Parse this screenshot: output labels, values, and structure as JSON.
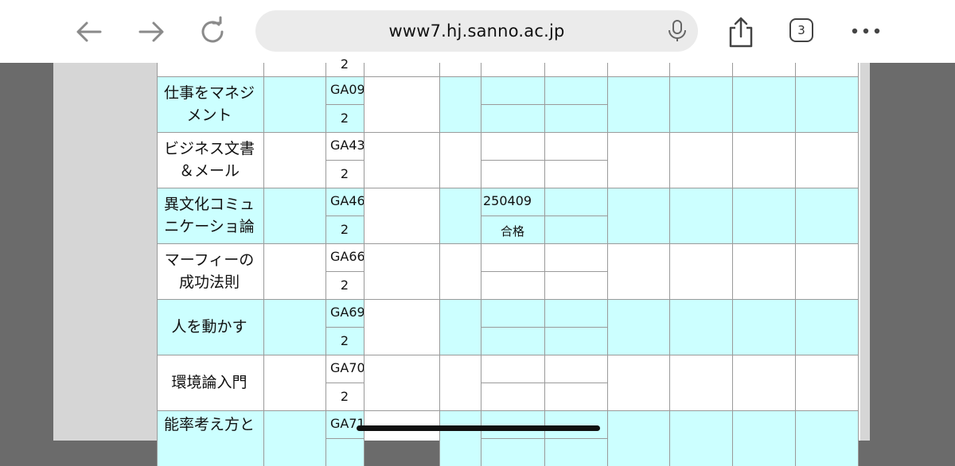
{
  "browser": {
    "url": "www7.hj.sanno.ac.jp",
    "tab_count": "3",
    "icons": [
      "back-arrow-icon",
      "forward-arrow-icon",
      "reload-icon",
      "microphone-icon",
      "share-icon",
      "tabs-icon",
      "more-icon"
    ]
  },
  "table": {
    "top_partial_credit": "2",
    "rows": [
      {
        "name": "仕事をマネジメント",
        "name_line1": "仕事をマネジ",
        "name_line2": "メント",
        "code": "GA09",
        "credit": "2",
        "date": "",
        "result": "",
        "shade": "cyan"
      },
      {
        "name_line1": "ビジネス文書",
        "name_line2": "＆メール",
        "code": "GA43",
        "credit": "2",
        "date": "",
        "result": "",
        "shade": "white"
      },
      {
        "name_line1": "異文化コミュ",
        "name_line2": "ニケーショ論",
        "code": "GA46",
        "credit": "2",
        "date": "250409",
        "result": "合格",
        "shade": "cyan"
      },
      {
        "name_line1": "マーフィーの",
        "name_line2": "成功法則",
        "code": "GA66",
        "credit": "2",
        "date": "",
        "result": "",
        "shade": "white"
      },
      {
        "name_line1": "人を動かす",
        "name_line2": "",
        "code": "GA69",
        "credit": "2",
        "date": "",
        "result": "",
        "shade": "cyan"
      },
      {
        "name_line1": "環境論入門",
        "name_line2": "",
        "code": "GA70",
        "credit": "2",
        "date": "",
        "result": "",
        "shade": "white"
      },
      {
        "name_line1": "能率考え方と",
        "name_line2": "",
        "code": "GA71",
        "credit": "",
        "date": "",
        "result": "",
        "shade": "cyan"
      }
    ]
  }
}
